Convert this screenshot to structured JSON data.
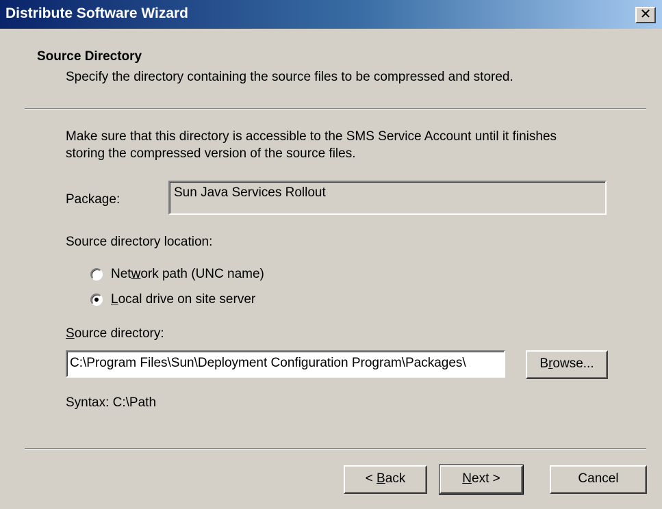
{
  "window": {
    "title": "Distribute Software Wizard",
    "close_label": "✕"
  },
  "header": {
    "title": "Source Directory",
    "subtitle": "Specify the directory containing the source files to be compressed and stored."
  },
  "body": {
    "intro_line1": "Make sure that this directory is accessible to the SMS Service Account until it finishes",
    "intro_line2": "storing the compressed version of the source files.",
    "package_label": "Package:",
    "package_value": "Sun Java Services Rollout",
    "location_label": "Source directory location:",
    "radio_network": {
      "pre": "Net",
      "accel": "w",
      "post": "ork path (UNC name)",
      "checked": false
    },
    "radio_local": {
      "pre": "",
      "accel": "L",
      "post": "ocal drive on site server",
      "checked": true
    },
    "dir_label": {
      "accel": "S",
      "post": "ource directory:"
    },
    "dir_value": "C:\\Program Files\\Sun\\Deployment Configuration Program\\Packages\\",
    "browse_label": {
      "pre": "B",
      "accel": "r",
      "post": "owse..."
    },
    "syntax_hint": "Syntax: C:\\Path"
  },
  "footer": {
    "back": {
      "pre": "< ",
      "accel": "B",
      "post": "ack"
    },
    "next": {
      "pre": "",
      "accel": "N",
      "post": "ext >"
    },
    "cancel": "Cancel"
  },
  "icons": {
    "close": "close-icon",
    "radio": "radio-button"
  }
}
